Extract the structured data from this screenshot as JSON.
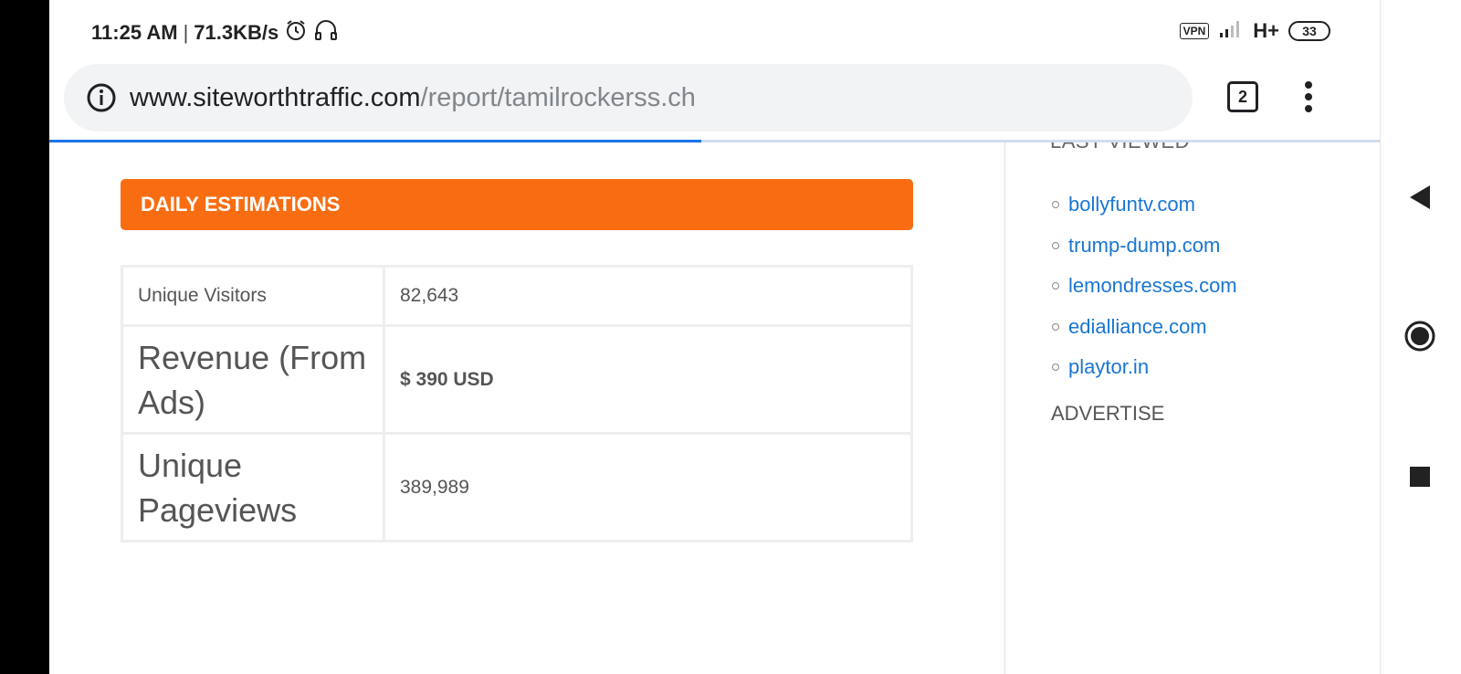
{
  "status_bar": {
    "time": "11:25 AM",
    "separator": "|",
    "speed": "71.3KB/s",
    "icons_left": [
      "alarm-icon",
      "headset-icon"
    ],
    "vpn": "VPN",
    "network": "H+",
    "battery": "33"
  },
  "browser": {
    "url_domain": "www.siteworthtraffic.com",
    "url_path": "/report/tamilrockerss.ch",
    "tab_count": "2",
    "load_progress": 0.49
  },
  "main": {
    "section_title": "DAILY ESTIMATIONS",
    "rows": [
      {
        "label": "Unique Visitors",
        "value": "82,643"
      },
      {
        "label": "Revenue (From Ads)",
        "value": "$ 390 USD"
      },
      {
        "label": "Unique Pageviews",
        "value": "389,989"
      }
    ],
    "accent_color": "#f96d12",
    "revenue_color": "#0a8a0a"
  },
  "sidebar": {
    "last_viewed_heading": "LAST VIEWED",
    "links": [
      "bollyfuntv.com",
      "trump-dump.com",
      "lemondresses.com",
      "edialliance.com",
      "playtor.in"
    ],
    "advertise_heading": "ADVERTISE",
    "link_color": "#1976d2"
  },
  "nav_buttons": [
    "back-icon",
    "home-icon",
    "recents-icon"
  ]
}
